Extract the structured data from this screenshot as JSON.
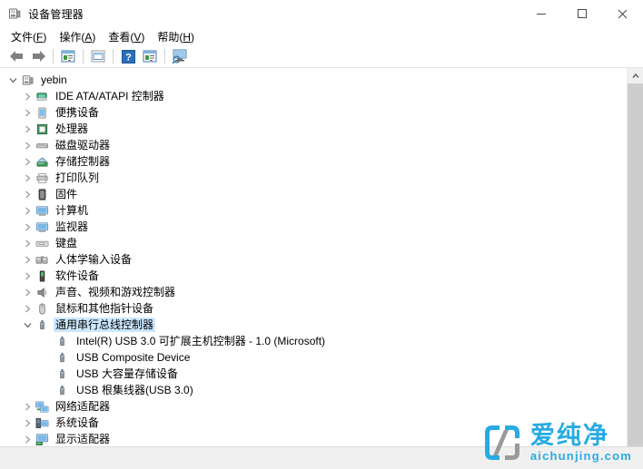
{
  "window": {
    "title": "设备管理器",
    "icon": "device-manager-icon",
    "controls": {
      "minimize": "—",
      "maximize": "□",
      "close": "✕"
    }
  },
  "menubar": {
    "items": [
      {
        "label": "文件(F)",
        "text": "文件(",
        "key": "F",
        "tail": ")"
      },
      {
        "label": "操作(A)",
        "text": "操作(",
        "key": "A",
        "tail": ")"
      },
      {
        "label": "查看(V)",
        "text": "查看(",
        "key": "V",
        "tail": ")"
      },
      {
        "label": "帮助(H)",
        "text": "帮助(",
        "key": "H",
        "tail": ")"
      }
    ]
  },
  "toolbar": {
    "buttons": [
      {
        "name": "back-button",
        "icon": "back-arrow-icon"
      },
      {
        "name": "forward-button",
        "icon": "forward-arrow-icon"
      },
      {
        "name": "properties-button",
        "icon": "properties-icon"
      },
      {
        "name": "show-hidden-button",
        "icon": "window-list-icon"
      },
      {
        "name": "help-button",
        "icon": "help-question-icon"
      },
      {
        "name": "update-driver-button",
        "icon": "update-driver-icon"
      },
      {
        "name": "scan-hardware-button",
        "icon": "scan-monitor-icon"
      }
    ]
  },
  "tree": {
    "root": {
      "label": "yebin",
      "icon": "device-manager-icon",
      "expanded": true
    },
    "nodes": [
      {
        "label": "IDE ATA/ATAPI 控制器",
        "icon": "ide-controller-icon",
        "expanded": false,
        "selected": false
      },
      {
        "label": "便携设备",
        "icon": "portable-device-icon",
        "expanded": false,
        "selected": false
      },
      {
        "label": "处理器",
        "icon": "processor-icon",
        "expanded": false,
        "selected": false
      },
      {
        "label": "磁盘驱动器",
        "icon": "disk-drive-icon",
        "expanded": false,
        "selected": false
      },
      {
        "label": "存储控制器",
        "icon": "storage-controller-icon",
        "expanded": false,
        "selected": false
      },
      {
        "label": "打印队列",
        "icon": "print-queue-icon",
        "expanded": false,
        "selected": false
      },
      {
        "label": "固件",
        "icon": "firmware-icon",
        "expanded": false,
        "selected": false
      },
      {
        "label": "计算机",
        "icon": "computer-icon",
        "expanded": false,
        "selected": false
      },
      {
        "label": "监视器",
        "icon": "monitor-icon",
        "expanded": false,
        "selected": false
      },
      {
        "label": "键盘",
        "icon": "keyboard-icon",
        "expanded": false,
        "selected": false
      },
      {
        "label": "人体学输入设备",
        "icon": "hid-icon",
        "expanded": false,
        "selected": false
      },
      {
        "label": "软件设备",
        "icon": "software-device-icon",
        "expanded": false,
        "selected": false
      },
      {
        "label": "声音、视频和游戏控制器",
        "icon": "sound-controller-icon",
        "expanded": false,
        "selected": false
      },
      {
        "label": "鼠标和其他指针设备",
        "icon": "mouse-icon",
        "expanded": false,
        "selected": false
      },
      {
        "label": "通用串行总线控制器",
        "icon": "usb-icon",
        "expanded": true,
        "selected": true
      },
      {
        "label": "网络适配器",
        "icon": "network-adapter-icon",
        "expanded": false,
        "selected": false
      },
      {
        "label": "系统设备",
        "icon": "system-device-icon",
        "expanded": false,
        "selected": false
      },
      {
        "label": "显示适配器",
        "icon": "display-adapter-icon",
        "expanded": false,
        "selected": false
      }
    ],
    "usb_children": [
      {
        "label": "Intel(R) USB 3.0 可扩展主机控制器 - 1.0 (Microsoft)",
        "icon": "usb-device-icon"
      },
      {
        "label": "USB Composite Device",
        "icon": "usb-device-icon"
      },
      {
        "label": "USB 大容量存储设备",
        "icon": "usb-device-icon"
      },
      {
        "label": "USB 根集线器(USB 3.0)",
        "icon": "usb-device-icon"
      }
    ]
  },
  "statusbar": {
    "text": ""
  },
  "watermark": {
    "cn": "爱纯净",
    "en": "aichunjing.com",
    "color": "#29abe2",
    "logo": "aichunjing-logo-icon"
  }
}
